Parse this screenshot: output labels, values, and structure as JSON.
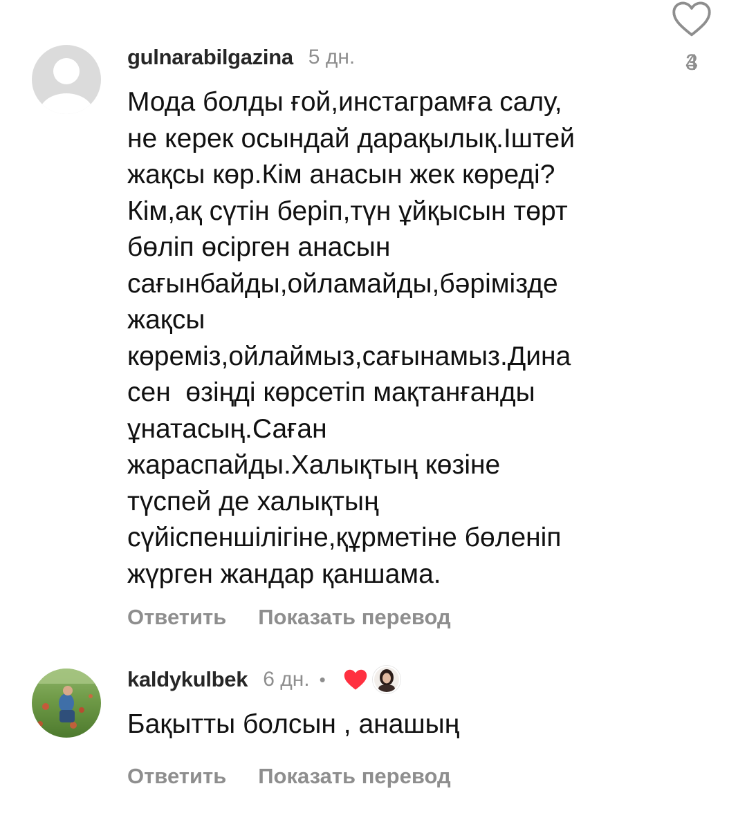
{
  "comments": [
    {
      "username": "gulnarabilgazina",
      "time": "5 дн.",
      "text": "Мода болды ғой,инстаграмға салу,\nне керек осындай дарақылық.Іштей\nжақсы көр.Кім анасын жек көреді?\nКім,ақ сүтін беріп,түн ұйқысын төрт\nбөліп өсірген анасын\nсағынбайды,ойламайды,бәрімізде\nжақсы\nкөреміз,ойлаймыз,сағынамыз.Дина\nсен  өзіңді көрсетіп мақтанғанды\nұнатасың.Саған\nжараспайды.Халықтың көзіне\nтүспей де халықтың\nсүйіспеншілігіне,құрметіне бөленіп\nжүрген жандар қаншама.",
      "reply_label": "Ответить",
      "translate_label": "Показать перевод",
      "like_count": "4"
    },
    {
      "username": "kaldykulbek",
      "time": "6 дн.",
      "separator": "•",
      "text": "Бақытты болсын , анашың",
      "reply_label": "Ответить",
      "translate_label": "Показать перевод",
      "like_count": "3",
      "liked_by_author": true
    }
  ],
  "icons": {
    "like": "heart-outline-icon",
    "author_like": "heart-filled-icon"
  },
  "colors": {
    "secondary_text": "#8e8e8e",
    "heart_red": "#ff3040"
  }
}
